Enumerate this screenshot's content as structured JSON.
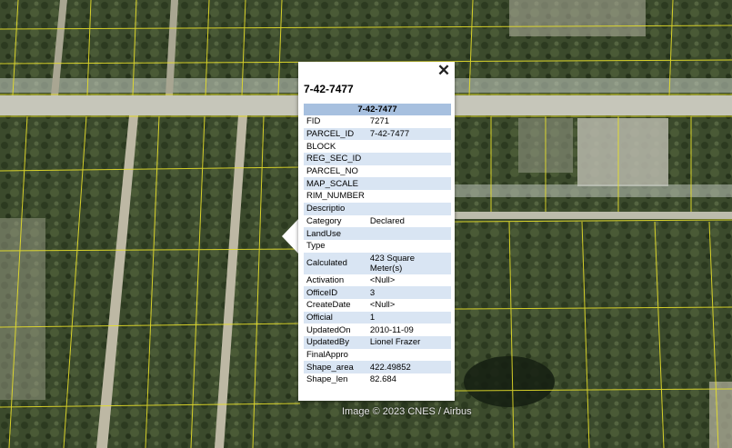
{
  "map": {
    "attribution": "Image © 2023 CNES / Airbus"
  },
  "popup": {
    "title": "7-42-7477",
    "close_label": "✕",
    "table_header": "7-42-7477",
    "rows": [
      {
        "key": "FID",
        "value": "7271"
      },
      {
        "key": "PARCEL_ID",
        "value": "7-42-7477"
      },
      {
        "key": "BLOCK",
        "value": ""
      },
      {
        "key": "REG_SEC_ID",
        "value": ""
      },
      {
        "key": "PARCEL_NO",
        "value": ""
      },
      {
        "key": "MAP_SCALE",
        "value": ""
      },
      {
        "key": "RIM_NUMBER",
        "value": ""
      },
      {
        "key": "Descriptio",
        "value": ""
      },
      {
        "key": "Category",
        "value": "Declared"
      },
      {
        "key": "LandUse",
        "value": ""
      },
      {
        "key": "Type",
        "value": ""
      },
      {
        "key": "Calculated",
        "value": "423 Square Meter(s)"
      },
      {
        "key": "Activation",
        "value": "<Null>"
      },
      {
        "key": "OfficeID",
        "value": "3"
      },
      {
        "key": "CreateDate",
        "value": "<Null>"
      },
      {
        "key": "Official",
        "value": "1"
      },
      {
        "key": "UpdatedOn",
        "value": "2010-11-09"
      },
      {
        "key": "UpdatedBy",
        "value": "Lionel Frazer"
      },
      {
        "key": "FinalAppro",
        "value": ""
      },
      {
        "key": "Shape_area",
        "value": "422.49852"
      },
      {
        "key": "Shape_len",
        "value": "82.684"
      }
    ],
    "colors": {
      "header_bg": "#a7c0df",
      "stripe_bg": "#d9e5f3"
    }
  }
}
